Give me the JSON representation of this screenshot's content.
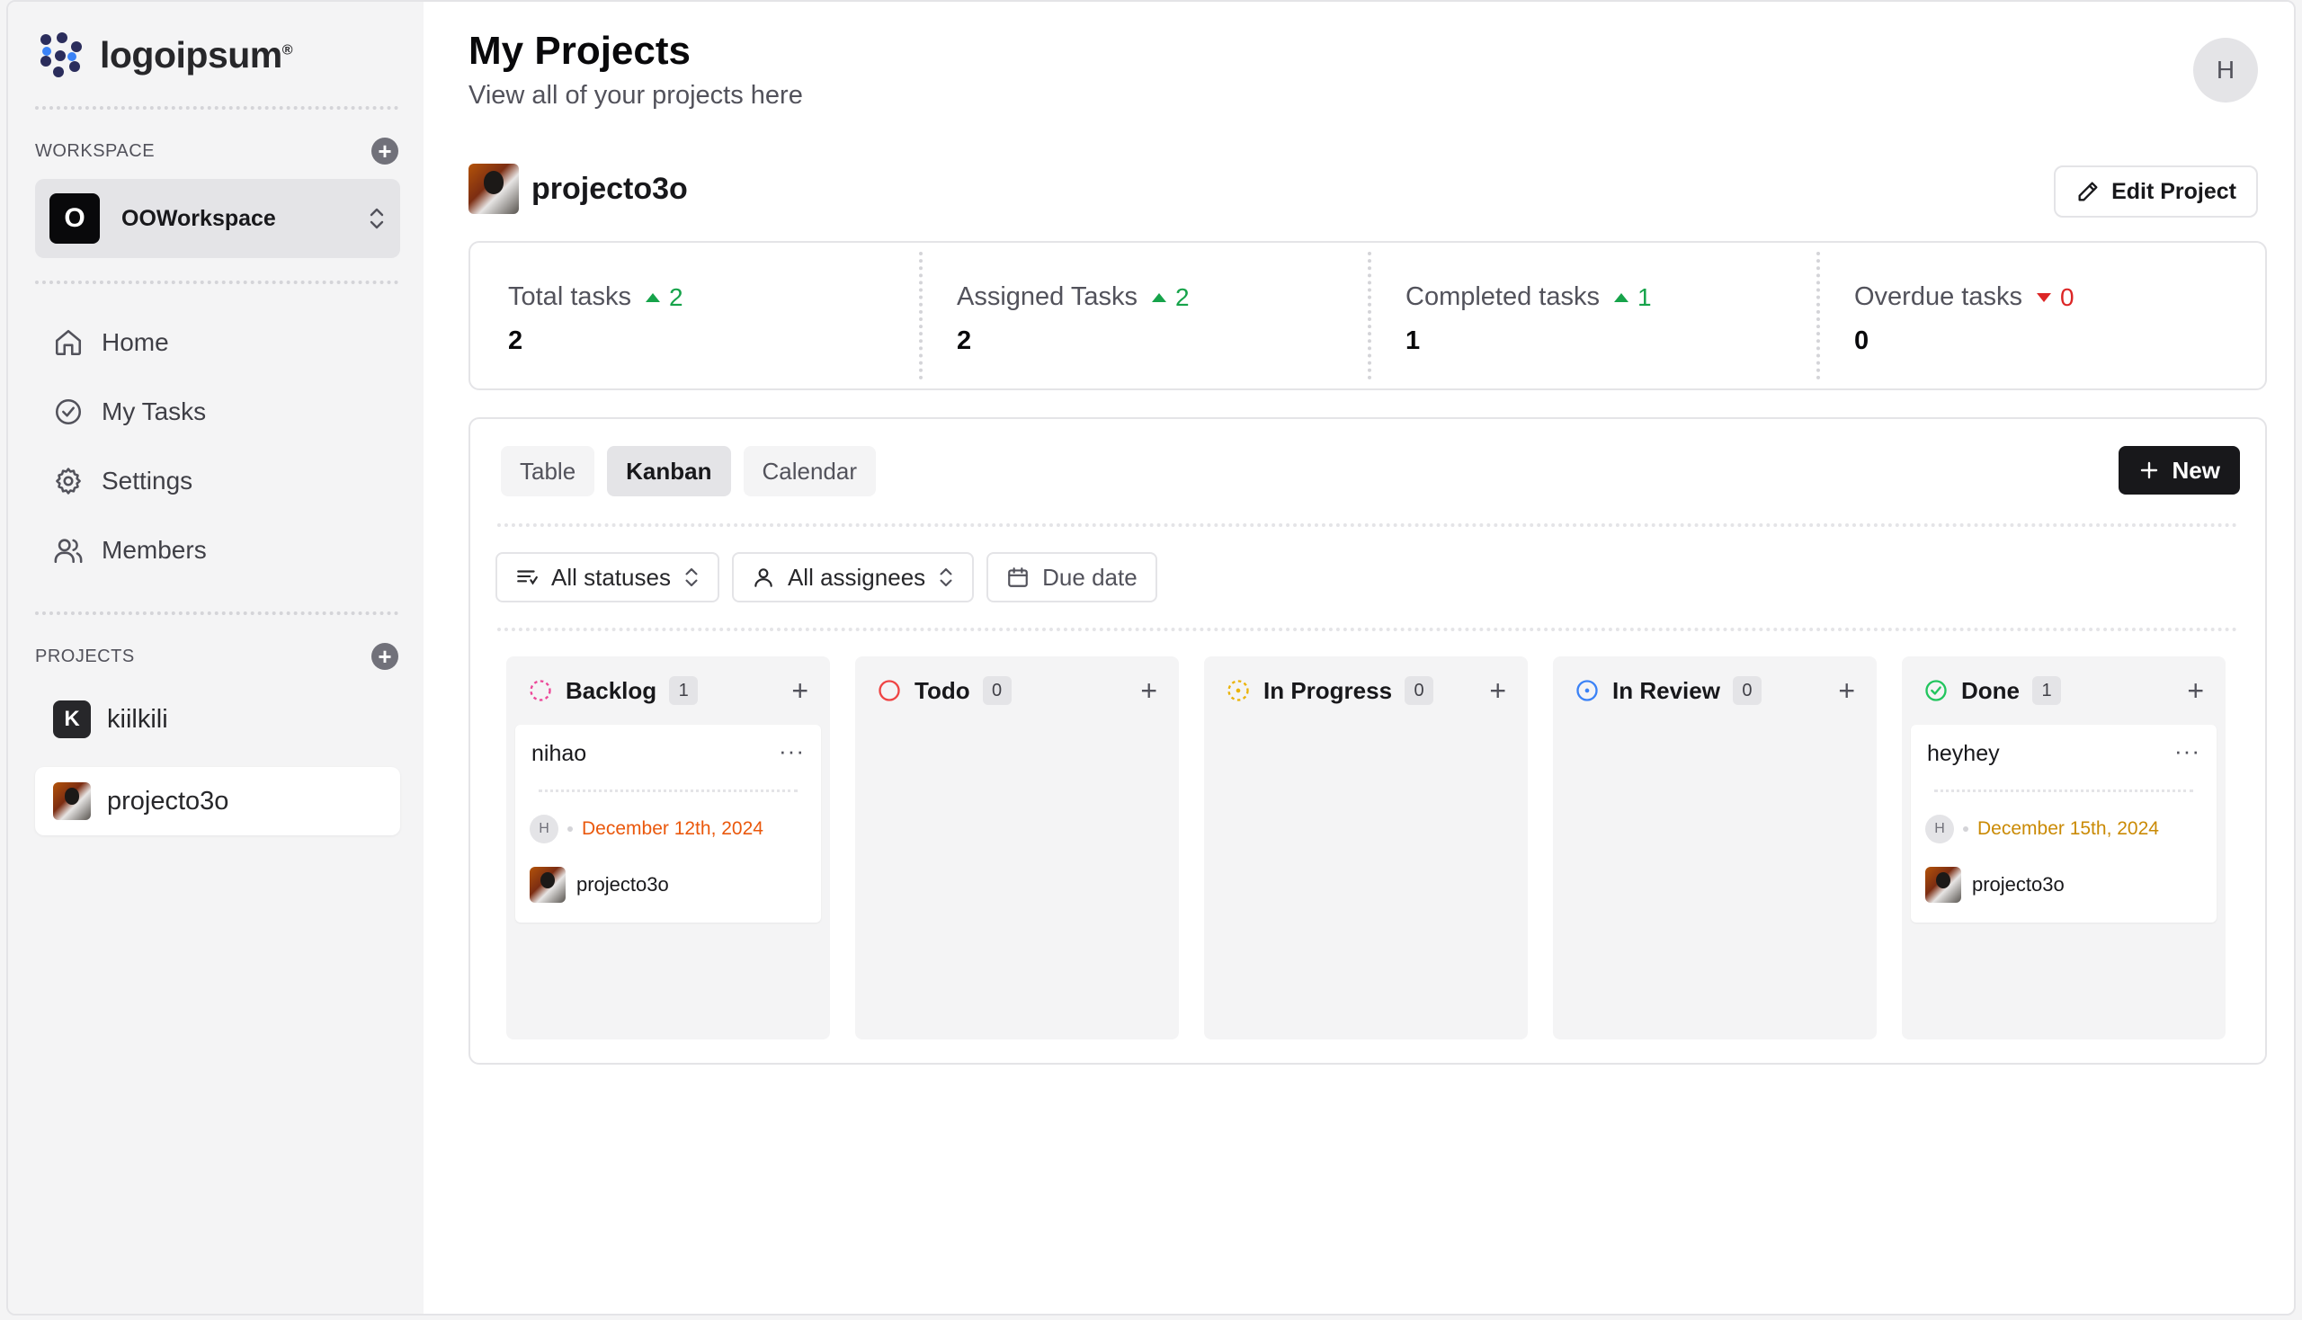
{
  "brand": {
    "name": "logoipsum",
    "mark": "®"
  },
  "sidebar": {
    "workspace_label": "WORKSPACE",
    "workspace": {
      "initial": "O",
      "name": "OOWorkspace"
    },
    "nav": [
      {
        "label": "Home",
        "icon": "home-icon"
      },
      {
        "label": "My Tasks",
        "icon": "check-circle-icon"
      },
      {
        "label": "Settings",
        "icon": "gear-icon"
      },
      {
        "label": "Members",
        "icon": "users-icon"
      }
    ],
    "projects_label": "PROJECTS",
    "projects": [
      {
        "initial": "K",
        "name": "kiilkili"
      },
      {
        "name": "projecto3o"
      }
    ]
  },
  "header": {
    "title": "My Projects",
    "subtitle": "View all of your projects here",
    "user_initial": "H"
  },
  "project": {
    "name": "projecto3o",
    "edit_label": "Edit Project"
  },
  "stats": [
    {
      "label": "Total tasks",
      "change": "2",
      "direction": "up",
      "value": "2"
    },
    {
      "label": "Assigned Tasks",
      "change": "2",
      "direction": "up",
      "value": "2"
    },
    {
      "label": "Completed tasks",
      "change": "1",
      "direction": "up",
      "value": "1"
    },
    {
      "label": "Overdue tasks",
      "change": "0",
      "direction": "down",
      "value": "0"
    }
  ],
  "views": {
    "tabs": [
      "Table",
      "Kanban",
      "Calendar"
    ],
    "active": "Kanban",
    "new_label": "New"
  },
  "filters": {
    "status": "All statuses",
    "assignee": "All assignees",
    "due_date": "Due date"
  },
  "columns": [
    {
      "title": "Backlog",
      "count": "1",
      "color": "#ec4899",
      "cards": [
        {
          "title": "nihao",
          "assignee": "H",
          "date": "December 12th, 2024",
          "date_color": "#ea580c",
          "project": "projecto3o"
        }
      ]
    },
    {
      "title": "Todo",
      "count": "0",
      "color": "#ef4444",
      "cards": []
    },
    {
      "title": "In Progress",
      "count": "0",
      "color": "#eab308",
      "cards": []
    },
    {
      "title": "In Review",
      "count": "0",
      "color": "#3b82f6",
      "cards": []
    },
    {
      "title": "Done",
      "count": "1",
      "color": "#22c55e",
      "cards": [
        {
          "title": "heyhey",
          "assignee": "H",
          "date": "December 15th, 2024",
          "date_color": "#ca8a04",
          "project": "projecto3o"
        }
      ]
    }
  ]
}
